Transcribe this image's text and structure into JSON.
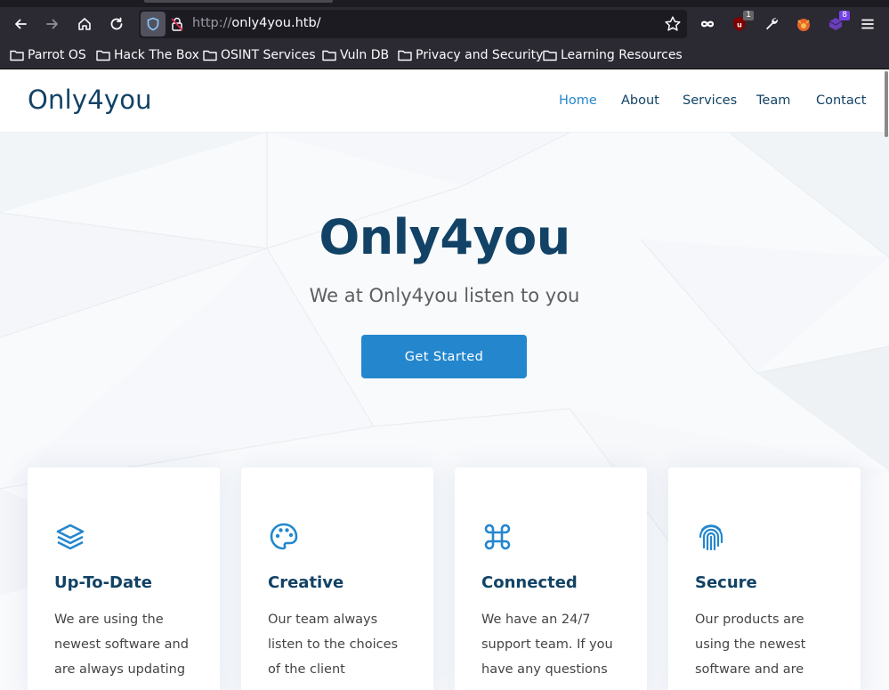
{
  "browser": {
    "url_protocol": "http://",
    "url_host": "only4you.htb/",
    "extensions": {
      "ublock_badge": "1",
      "ext_badge": "8"
    },
    "bookmarks": [
      {
        "label": "Parrot OS"
      },
      {
        "label": "Hack The Box"
      },
      {
        "label": "OSINT Services"
      },
      {
        "label": "Vuln DB"
      },
      {
        "label": "Privacy and Security"
      },
      {
        "label": "Learning Resources"
      }
    ]
  },
  "site": {
    "logo": "Only4you",
    "nav": [
      {
        "label": "Home"
      },
      {
        "label": "About"
      },
      {
        "label": "Services"
      },
      {
        "label": "Team"
      },
      {
        "label": "Contact"
      }
    ],
    "hero": {
      "title": "Only4you",
      "subtitle": "We at Only4you listen to you",
      "cta": "Get Started"
    },
    "features": [
      {
        "icon": "layers-icon",
        "title": "Up-To-Date",
        "text": "We are using the newest software and are always updating"
      },
      {
        "icon": "palette-icon",
        "title": "Creative",
        "text": "Our team always listen to the choices of the client"
      },
      {
        "icon": "command-icon",
        "title": "Connected",
        "text": "We have an 24/7 support team. If you have any questions"
      },
      {
        "icon": "fingerprint-icon",
        "title": "Secure",
        "text": "Our products are using the newest software and are"
      }
    ]
  },
  "colors": {
    "accent": "#2487ce",
    "heading": "#124265",
    "chrome": "#2b2a33"
  }
}
